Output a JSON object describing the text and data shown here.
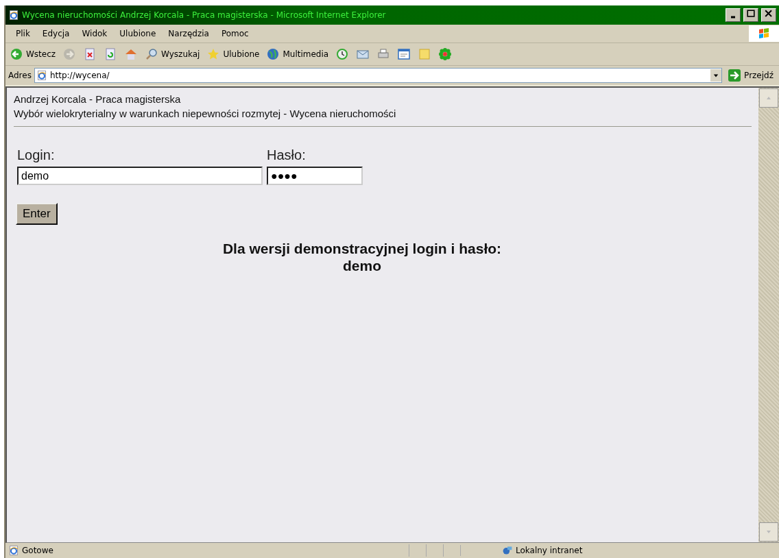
{
  "window": {
    "title": "Wycena nieruchomości Andrzej Korcala - Praca magisterska - Microsoft Internet Explorer"
  },
  "menu": [
    "Plik",
    "Edycja",
    "Widok",
    "Ulubione",
    "Narzędzia",
    "Pomoc"
  ],
  "toolbar": [
    {
      "kind": "back",
      "label": "Wstecz",
      "disabled": false
    },
    {
      "kind": "forward",
      "disabled": true
    },
    {
      "kind": "stop",
      "disabled": false
    },
    {
      "kind": "refresh",
      "disabled": false
    },
    {
      "kind": "home",
      "disabled": false
    },
    {
      "kind": "search",
      "label": "Wyszukaj",
      "disabled": false
    },
    {
      "kind": "favorites",
      "label": "Ulubione",
      "disabled": false
    },
    {
      "kind": "media",
      "label": "Multimedia",
      "disabled": false
    },
    {
      "kind": "history",
      "disabled": false
    },
    {
      "kind": "mail",
      "disabled": false
    },
    {
      "kind": "print",
      "disabled": false
    },
    {
      "kind": "edit",
      "disabled": false
    },
    {
      "kind": "note",
      "disabled": false
    },
    {
      "kind": "flower",
      "disabled": false
    }
  ],
  "address": {
    "label": "Adres",
    "value": "http://wycena/",
    "go": "Przejdź"
  },
  "page": {
    "heading": [
      "Andrzej Korcala - Praca magisterska",
      "Wybór wielokryterialny w warunkach niepewności rozmytej - Wycena nieruchomości"
    ],
    "login": {
      "label": "Login:",
      "value": "demo"
    },
    "password": {
      "label": "Hasło:",
      "value": "●●●●"
    },
    "button": "Enter",
    "notice": [
      "Dla wersji demonstracyjnej login i hasło:",
      "demo"
    ]
  },
  "status_bar": {
    "text": "Gotowe",
    "zone": "Lokalny intranet"
  }
}
